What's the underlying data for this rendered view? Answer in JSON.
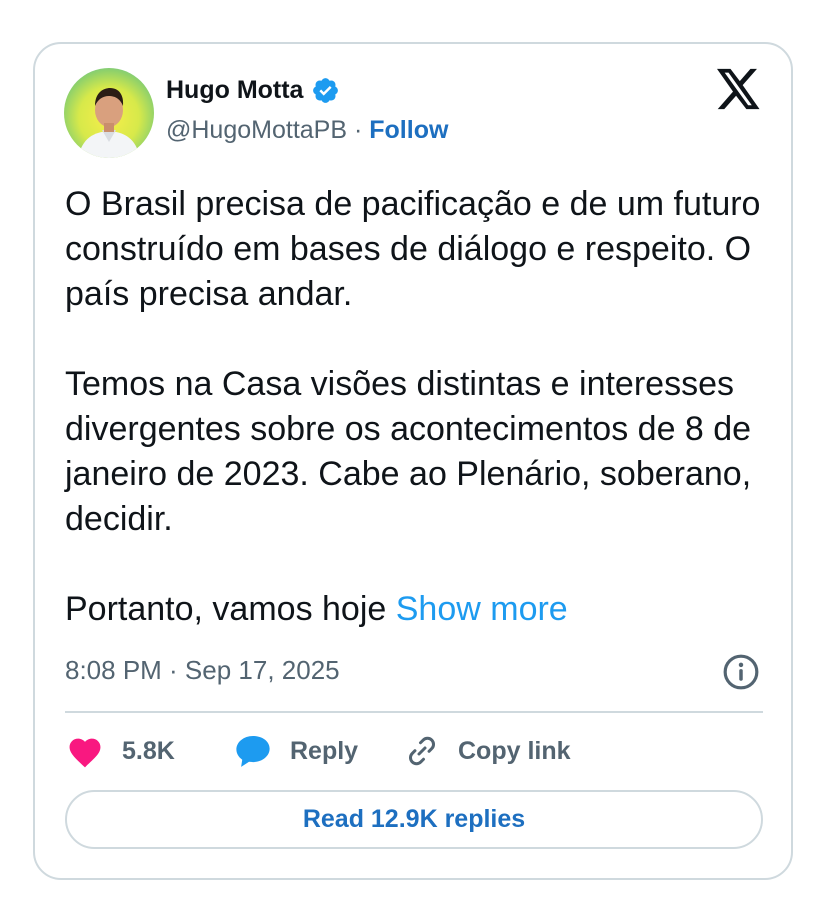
{
  "author": {
    "name": "Hugo Motta",
    "handle": "@HugoMottaPB",
    "separator": "·",
    "follow_label": "Follow"
  },
  "icons": {
    "brand": "x-logo-icon",
    "verified": "verified-badge-icon",
    "info": "info-icon",
    "like": "heart-icon",
    "reply": "reply-bubble-icon",
    "copy": "link-icon"
  },
  "colors": {
    "accent": "#1d9bf0",
    "verified": "#1d9bf0",
    "like": "#f91880",
    "text": "#0f1419",
    "muted": "#536471",
    "border": "#cfd9de"
  },
  "tweet": {
    "paragraph1": "O Brasil precisa de pacificação e de um futuro construído em bases de diálogo e respeito. O país precisa andar.",
    "paragraph2": "Temos na Casa visões distintas e interesses divergentes sobre os acontecimentos de 8 de janeiro de 2023. Cabe ao Plenário, soberano, decidir.",
    "paragraph3": "Portanto, vamos hoje",
    "show_more": "Show more",
    "timestamp": "8:08 PM · Sep 17, 2025"
  },
  "actions": {
    "likes": "5.8K",
    "reply": "Reply",
    "copy_link": "Copy link",
    "read_replies": "Read 12.9K replies"
  }
}
